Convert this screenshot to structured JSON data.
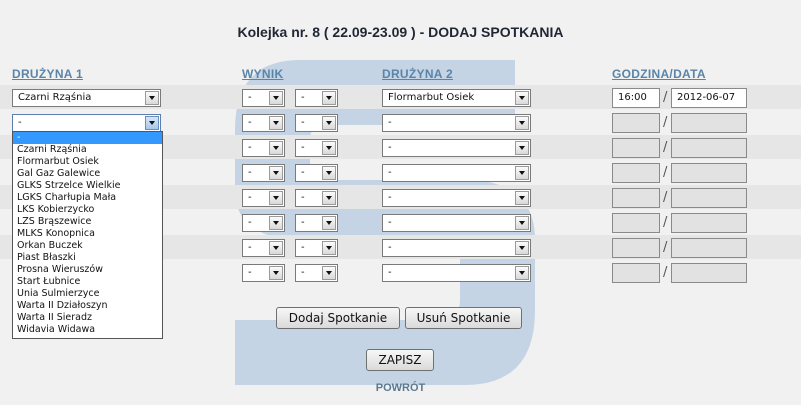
{
  "page": {
    "title": "Kolejka nr. 8 ( 22.09-23.09 ) - DODAJ SPOTKANIA"
  },
  "headers": {
    "team1": "DRUŻYNA 1",
    "score": "WYNIK",
    "team2": "DRUŻYNA 2",
    "datetime": "GODZINA/DATA"
  },
  "rows": [
    {
      "team1": "Czarni Rząśnia",
      "score1": "-",
      "score2": "-",
      "team2": "Flormarbut Osiek",
      "time": "16:00",
      "date": "2012-06-07"
    },
    {
      "team1": "-",
      "score1": "-",
      "score2": "-",
      "team2": "-",
      "time": "",
      "date": ""
    },
    {
      "team1": "-",
      "score1": "-",
      "score2": "-",
      "team2": "-",
      "time": "",
      "date": ""
    },
    {
      "team1": "-",
      "score1": "-",
      "score2": "-",
      "team2": "-",
      "time": "",
      "date": ""
    },
    {
      "team1": "-",
      "score1": "-",
      "score2": "-",
      "team2": "-",
      "time": "",
      "date": ""
    },
    {
      "team1": "-",
      "score1": "-",
      "score2": "-",
      "team2": "-",
      "time": "",
      "date": ""
    },
    {
      "team1": "-",
      "score1": "-",
      "score2": "-",
      "team2": "-",
      "time": "",
      "date": ""
    },
    {
      "team1": "-",
      "score1": "-",
      "score2": "-",
      "team2": "-",
      "time": "",
      "date": ""
    }
  ],
  "dropdown": {
    "open_row": 1,
    "selected": "-",
    "options": [
      "-",
      "Czarni Rząśnia",
      "Flormarbut Osiek",
      "Gal Gaz Galewice",
      "GLKS Strzelce Wielkie",
      "LGKS Charłupia Mała",
      "LKS Kobierzycko",
      "LZS Brąszewice",
      "MLKS Konopnica",
      "Orkan Buczek",
      "Piast Błaszki",
      "Prosna Wieruszów",
      "Start Łubnice",
      "Unia Sulmierzyce",
      "Warta II Działoszyn",
      "Warta II Sieradz",
      "Widavia Widawa"
    ]
  },
  "buttons": {
    "add": "Dodaj Spotkanie",
    "remove": "Usuń Spotkanie",
    "save": "ZAPISZ"
  },
  "back_link": "POWRÓT",
  "colors": {
    "header_link": "#5a84a8",
    "dropdown_highlight": "#3399ff",
    "watermark": "#8fb2d6"
  }
}
